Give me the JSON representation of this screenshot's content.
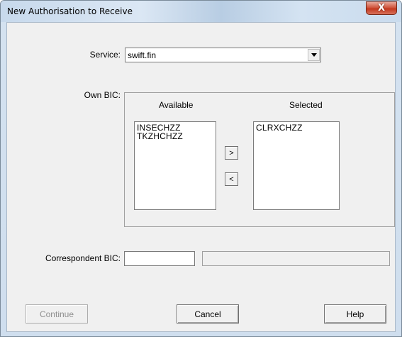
{
  "window": {
    "title": "New Authorisation to Receive",
    "close_label": "X"
  },
  "service": {
    "label": "Service:",
    "value": "swift.fin"
  },
  "own_bic": {
    "label": "Own BIC:",
    "available_header": "Available",
    "selected_header": "Selected",
    "available_items": [
      "INSECHZZ",
      "TKZHCHZZ"
    ],
    "selected_items": [
      "CLRXCHZZ"
    ],
    "add_label": ">",
    "remove_label": "<"
  },
  "correspondent": {
    "label": "Correspondent BIC:",
    "value": "",
    "description": ""
  },
  "buttons": {
    "continue": "Continue",
    "cancel": "Cancel",
    "help": "Help"
  }
}
